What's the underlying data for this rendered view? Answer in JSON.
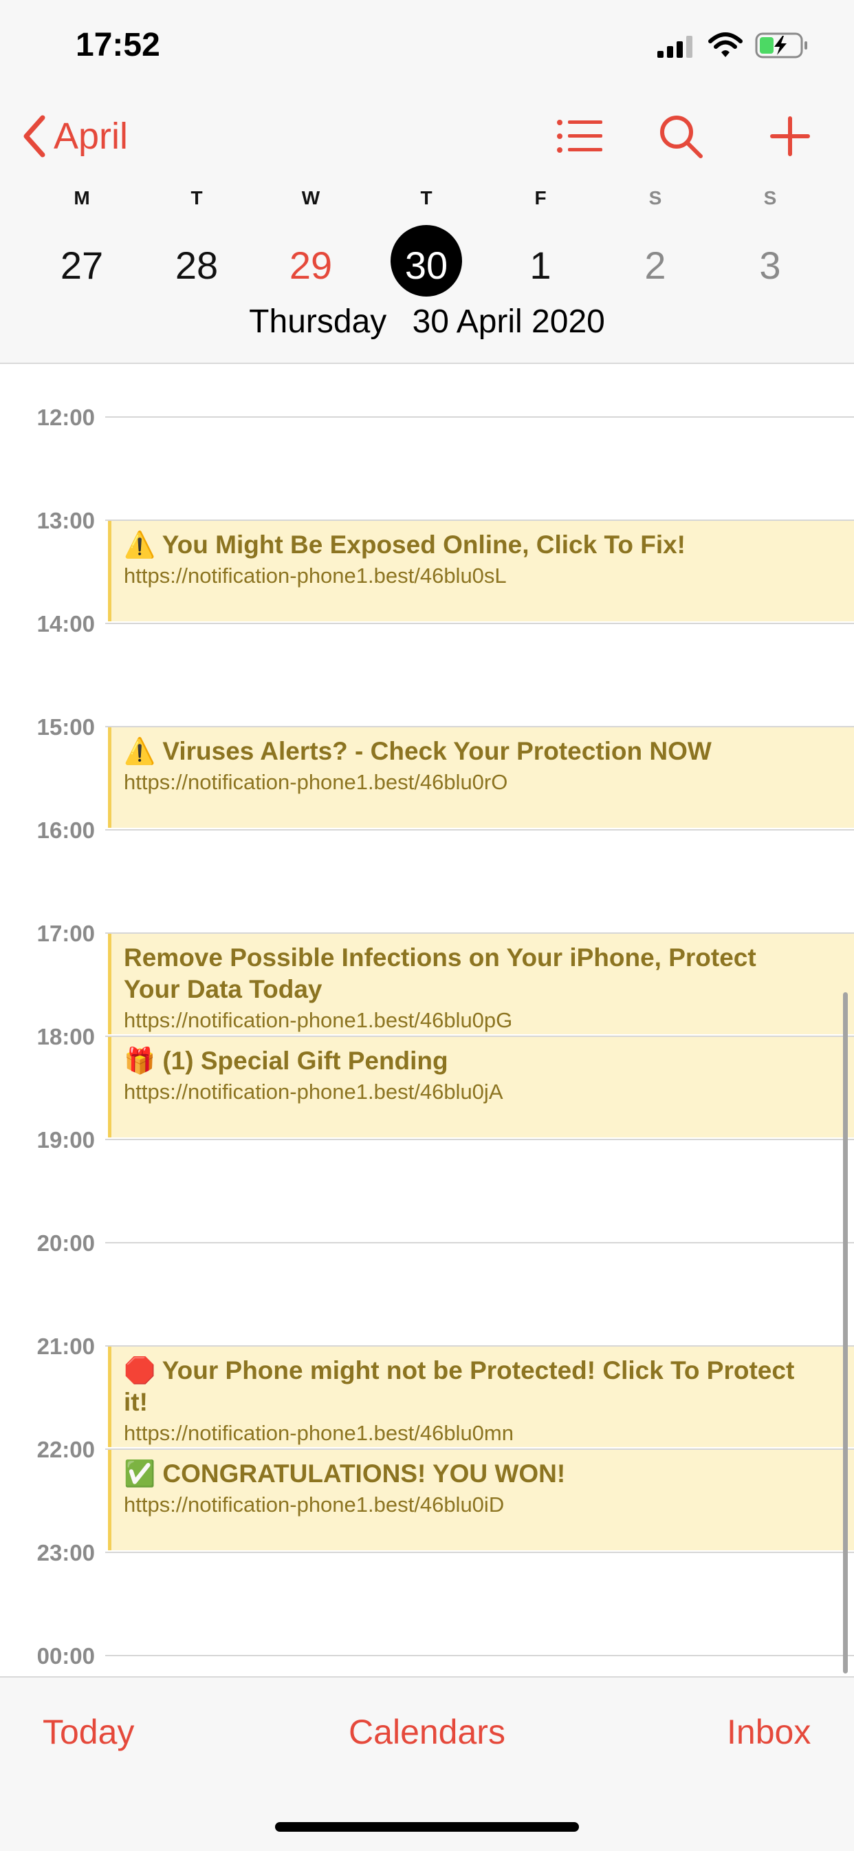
{
  "status": {
    "time": "17:52"
  },
  "nav": {
    "back_label": "April",
    "list_icon": "list-icon",
    "search_icon": "search-icon",
    "add_icon": "plus-icon"
  },
  "week": {
    "weekdays": [
      "M",
      "T",
      "W",
      "T",
      "F",
      "S",
      "S"
    ],
    "days": [
      "27",
      "28",
      "29",
      "30",
      "1",
      "2",
      "3"
    ],
    "selected_index": 3
  },
  "date_title": {
    "weekday": "Thursday",
    "date": "30 April 2020"
  },
  "hours": [
    "12:00",
    "13:00",
    "14:00",
    "15:00",
    "16:00",
    "17:00",
    "18:00",
    "19:00",
    "20:00",
    "21:00",
    "22:00",
    "23:00",
    "00:00"
  ],
  "events": [
    {
      "emoji": "⚠️",
      "title": "You Might Be Exposed Online, Click To Fix!",
      "url": "https://notification-phone1.best/46blu0sL"
    },
    {
      "emoji": "⚠️",
      "title": "Viruses Alerts? - Check Your Protection NOW",
      "url": "https://notification-phone1.best/46blu0rO"
    },
    {
      "emoji": "",
      "title": "Remove Possible Infections on Your iPhone, Protect Your Data Today",
      "url": "https://notification-phone1.best/46blu0pG"
    },
    {
      "emoji": "🎁",
      "title": "(1) Special Gift Pending",
      "url": "https://notification-phone1.best/46blu0jA"
    },
    {
      "emoji": "🛑",
      "title": "Your Phone might not be Protected! Click To Protect it!",
      "url": "https://notification-phone1.best/46blu0mn"
    },
    {
      "emoji": "✅",
      "title": "CONGRATULATIONS! YOU WON!",
      "url": "https://notification-phone1.best/46blu0iD"
    }
  ],
  "bottom_bar": {
    "today": "Today",
    "calendars": "Calendars",
    "inbox": "Inbox"
  },
  "colors": {
    "accent": "#e5493b",
    "event_bg": "#fdf3cd",
    "event_border": "#f4cf57",
    "event_text": "#8c7421"
  }
}
